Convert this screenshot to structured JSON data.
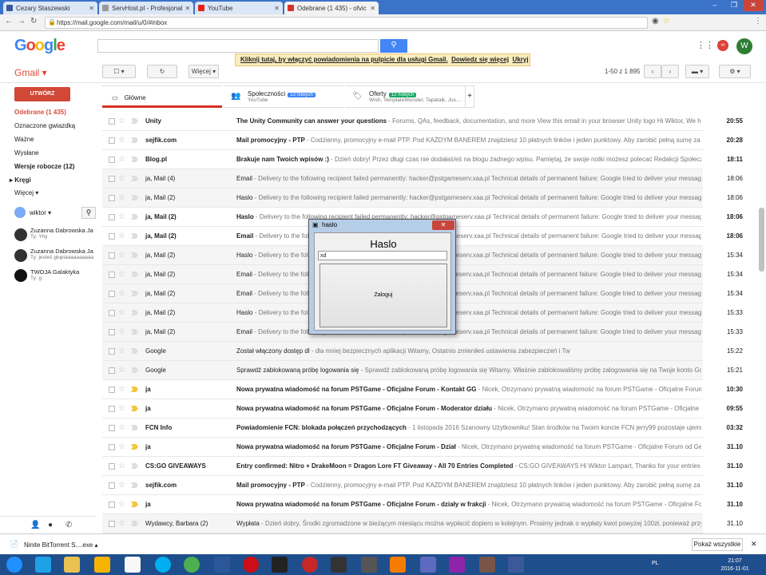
{
  "browser": {
    "tabs": [
      {
        "label": "Cezary Staszewski",
        "color": "#3b5998"
      },
      {
        "label": "ServHost.pl - Profesjonal",
        "color": "#888888"
      },
      {
        "label": "YouTube",
        "color": "#e62117"
      },
      {
        "label": "Odebrane (1 435) - ofvic",
        "color": "#d93025"
      }
    ],
    "url": "https://mail.google.com/mail/u/0/#inbox"
  },
  "header": {
    "logo": "Google",
    "notification": {
      "text": "Kliknij tutaj, by włączyć powiadomienia na pulpicie dla usługi Gmail.",
      "learn": "Dowiedz się więcej",
      "hide": "Ukryj"
    },
    "avatar_letter": "W"
  },
  "toolbar": {
    "app_label": "Gmail",
    "more": "Więcej",
    "range": "1-50 z 1 895"
  },
  "sidebar": {
    "compose": "UTWÓRZ",
    "items": [
      "Odebrane (1 435)",
      "Oznaczone gwiazdką",
      "Ważne",
      "Wysłane",
      "Wersje robocze (12)",
      "Kręgi",
      "Więcej"
    ],
    "user": "wiktor",
    "chats": [
      {
        "name": "Zuzanna Dabrowska Ja",
        "sub": "Ty: Yhy"
      },
      {
        "name": "Zuzanna Dabrowska Ja",
        "sub": "Ty: jesteś głupiaaaaaaaaaa"
      },
      {
        "name": "TWOJA Galaktyka",
        "sub": "Ty: g"
      }
    ]
  },
  "categories": [
    {
      "label": "Główne",
      "sub": "",
      "badge": ""
    },
    {
      "label": "Społeczności",
      "sub": "YouTube",
      "badge": "13 nowych",
      "badge_color": "#4285f4"
    },
    {
      "label": "Oferty",
      "sub": "Wish, TemplateMonster, Tapatalk, Jus…",
      "badge": "12 nowych",
      "badge_color": "#16a765"
    }
  ],
  "emails": [
    {
      "from": "Unity",
      "subject": "The Unity Community can answer your questions",
      "snippet": " - Forums, QAs, feedback, documentation, and more View this email in your browser Unity logo Hi Wiktor, We hope y",
      "date": "20:55",
      "unread": true
    },
    {
      "from": "sejfik.com",
      "subject": "Mail promocyjny - PTP",
      "snippet": " - Codzienny, promocyjny e-mail PTP. Pod KAŻDYM BANEREM znajdziesz 10 płatnych linków i jeden punktowy. Aby zarobić pełną sumę za maila",
      "date": "20:28",
      "unread": true
    },
    {
      "from": "Blog.pl",
      "subject": "Brakuje nam Twoich wpisów :)",
      "snippet": " - Dzień dobry! Przez długi czas nie dodałaś/eś na blogu żadnego wpisu. Pamiętaj, że swoje notki możesz polecać Redakcji Społeczności",
      "date": "18:11",
      "unread": true
    },
    {
      "from": "ja, Mail (4)",
      "subject": "Email",
      "snippet": " - Delivery to the following recipient failed permanently: hacker@pstgameserv.xaa.pl Technical details of permanent failure: Google tried to deliver your message, but",
      "date": "18:06",
      "unread": false
    },
    {
      "from": "ja, Mail (2)",
      "subject": "Haslo",
      "snippet": " - Delivery to the following recipient failed permanently: hacker@pstgameserv.xaa.pl Technical details of permanent failure: Google tried to deliver your message, but",
      "date": "18:06",
      "unread": false
    },
    {
      "from": "ja, Mail (2)",
      "subject": "Haslo",
      "snippet": " - Delivery to the following recipient failed permanently: hacker@pstgameserv.xaa.pl Technical details of permanent failure: Google tried to deliver your message, but",
      "date": "18:06",
      "unread": true
    },
    {
      "from": "ja, Mail (2)",
      "subject": "Email",
      "snippet": " - Delivery to the following recipient failed permanently: hacker@pstgameserv.xaa.pl Technical details of permanent failure: Google tried to deliver your message, but",
      "date": "18:06",
      "unread": true
    },
    {
      "from": "ja, Mail (2)",
      "subject": "Haslo",
      "snippet": " - Delivery to the following recipient failed permanently: hacker@pstgameserv.xaa.pl Technical details of permanent failure: Google tried to deliver your message, but",
      "date": "15:34",
      "unread": false
    },
    {
      "from": "ja, Mail (2)",
      "subject": "Email",
      "snippet": " - Delivery to the following recipient failed permanently: hacker@pstgameserv.xaa.pl Technical details of permanent failure: Google tried to deliver your message, but",
      "date": "15:34",
      "unread": false
    },
    {
      "from": "ja, Mail (2)",
      "subject": "Email",
      "snippet": " - Delivery to the following recipient failed permanently: hacker@pstgameserv.xaa.pl Technical details of permanent failure: Google tried to deliver your message, but",
      "date": "15:34",
      "unread": false
    },
    {
      "from": "ja, Mail (2)",
      "subject": "Haslo",
      "snippet": " - Delivery to the following recipient failed permanently: hacker@pstgameserv.xaa.pl Technical details of permanent failure: Google tried to deliver your message, but",
      "date": "15:33",
      "unread": false
    },
    {
      "from": "ja, Mail (2)",
      "subject": "Email",
      "snippet": " - Delivery to the following recipient failed permanently: hacker@pstgameserv.xaa.pl Technical details of permanent failure: Google tried to deliver your message, but",
      "date": "15:33",
      "unread": false
    },
    {
      "from": "Google",
      "subject": "Został włączony dostęp dl",
      "snippet": " - dla mniej bezpiecznych aplikacji Witamy, Ostatnio zmieniłeś ustawienia zabezpieczeń i Tw",
      "date": "15:22",
      "unread": false
    },
    {
      "from": "Google",
      "subject": "Sprawdź zablokowaną próbę logowania się",
      "snippet": " - Sprawdź zablokowaną próbę logowania się Witamy. Właśnie zablokowaliśmy próbę zalogowania się na Twoje konto Google (c",
      "date": "15:21",
      "unread": false
    },
    {
      "from": "ja",
      "subject": "Nowa prywatna wiadomość na forum PSTGame - Oficjalne Forum - Kontakt GG",
      "snippet": " - Nicek, Otrzymano prywatną wiadomość na forum PSTGame - Oficjalne Forum od G",
      "date": "10:30",
      "unread": true,
      "important": true
    },
    {
      "from": "ja",
      "subject": "Nowa prywatna wiadomość na forum PSTGame - Oficjalne Forum - Moderator działu",
      "snippet": " - Nicek, Otrzymano prywatną wiadomość na forum PSTGame - Oficjalne Fo",
      "date": "09:55",
      "unread": true,
      "important": true
    },
    {
      "from": "FCN Info",
      "subject": "Powiadomienie FCN: blokada połączeń przychodzących",
      "snippet": " - 1 listopada 2016 Szanowny Użytkowniku! Stan środków na Twoim koncie FCN jerry99 pozostaje ujemny od",
      "date": "03:32",
      "unread": true
    },
    {
      "from": "ja",
      "subject": "Nowa prywatna wiadomość na forum PSTGame - Oficjalne Forum - Dział",
      "snippet": " - Nicek, Otrzymano prywatną wiadomość na forum PSTGame - Oficjalne Forum od Geraldis",
      "date": "31.10",
      "unread": true,
      "important": true
    },
    {
      "from": "CS:GO GIVEAWAYS",
      "subject": "Entry confirmed: Nitro + DrakeMoon = Dragon Lore FT Giveaway - All 70 Entries Completed",
      "snippet": " - CS:GO GIVEAWAYS Hi Wiktor Lampart, Thanks for your entries into",
      "date": "31.10",
      "unread": true
    },
    {
      "from": "sejfik.com",
      "subject": "Mail promocyjny - PTP",
      "snippet": " - Codzienny, promocyjny e-mail PTP. Pod KAŻDYM BANEREM znajdziesz 10 płatnych linków i jeden punktowy. Aby zarobić pełną sumę za maila",
      "date": "31.10",
      "unread": true
    },
    {
      "from": "ja",
      "subject": "Nowa prywatna wiadomość na forum PSTGame - Oficjalne Forum - działy w frakcji",
      "snippet": " - Nicek, Otrzymano prywatną wiadomość na forum PSTGame - Oficjalne Forum",
      "date": "31.10",
      "unread": true,
      "important": true
    },
    {
      "from": "Wydawcy, Barbara (2)",
      "subject": "Wypłata",
      "snippet": " - Dzień dobry, Środki zgromadzone w bieżącym miesiącu można wypłacić dopiero w kolejnym. Prosimy jednak o wypłaty kwot powyżej 100zł, ponieważ przy wypła",
      "date": "31.10",
      "unread": false
    },
    {
      "from": "sejfik.com",
      "subject": "Mail promocyjny - PTP",
      "snippet": " - Codzienny, promocyjny e-mail PTP. Pod KAŻDYM BANEREM znajdziesz 10 płatnych linków i jeden punktowy. Aby zarobić pełną sumę za maila",
      "date": "31.10",
      "unread": true
    }
  ],
  "dialog": {
    "title": "haslo",
    "heading": "Haslo",
    "input_value": "xd",
    "button": "Zaloguj"
  },
  "downloads": {
    "file": "Ninite BitTorrent S....exe",
    "show_all": "Pokaż wszystkie"
  },
  "taskbar": {
    "lang": "PL",
    "time": "21:07",
    "date": "2016-11-01"
  }
}
